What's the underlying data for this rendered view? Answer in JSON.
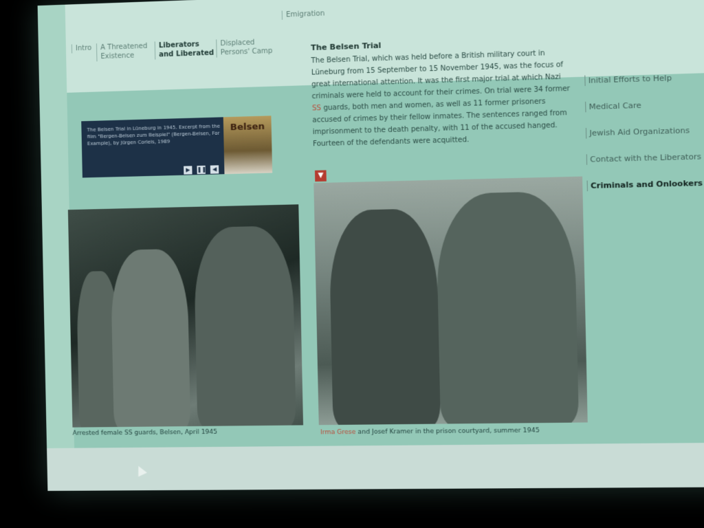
{
  "topnav": {
    "items": [
      {
        "label": "Intro"
      },
      {
        "label": "A Threatened Existence"
      },
      {
        "label": "Liberators and Liberated",
        "active": true
      },
      {
        "label": "Displaced Persons' Camp"
      },
      {
        "label": "Emigration"
      }
    ]
  },
  "player": {
    "text": "The Belsen Trial in Lüneburg in 1945. Excerpt from the film \"Bergen-Belsen zum Beispiel\" (Bergen-Belsen, For Example), by Jürgen Corleis, 1989",
    "thumb_label": "Belsen",
    "controls": [
      {
        "icon": "play-icon",
        "glyph": "▶"
      },
      {
        "icon": "pause-icon",
        "glyph": "❚❚"
      },
      {
        "icon": "volume-icon",
        "glyph": "◀"
      }
    ]
  },
  "trial": {
    "title": "The Belsen Trial",
    "body_before": "The Belsen Trial, which was held before a British military court in Lüneburg from 15 September to 15 November 1945, was the focus of great international attention. It was the first major trial at which Nazi criminals were held to account for their crimes. On trial were 34 former ",
    "ss_link": "SS",
    "body_after": " guards, both men and women, as well as 11 former prisoners accused of crimes by their fellow inmates. The sentences ranged from imprisonment to the death penalty, with 11 of the accused hanged. Fourteen of the defendants were acquitted."
  },
  "sidebar": {
    "items": [
      {
        "label": "Initial Efforts to Help"
      },
      {
        "label": "Medical Care"
      },
      {
        "label": "Jewish Aid Organizations"
      },
      {
        "label": "Contact with the Liberators"
      },
      {
        "label": "Criminals and Onlookers",
        "active": true
      }
    ]
  },
  "photos": {
    "left_caption": "Arrested female SS guards, Belsen, April 1945",
    "right_caption_name": "Irma Grese",
    "right_caption_rest": " and Josef Kramer in the prison courtyard, summer 1945"
  },
  "colors": {
    "screen_bg": "#a8d4c4",
    "accent_red": "#b53c30",
    "player_bg": "#1d3147"
  }
}
